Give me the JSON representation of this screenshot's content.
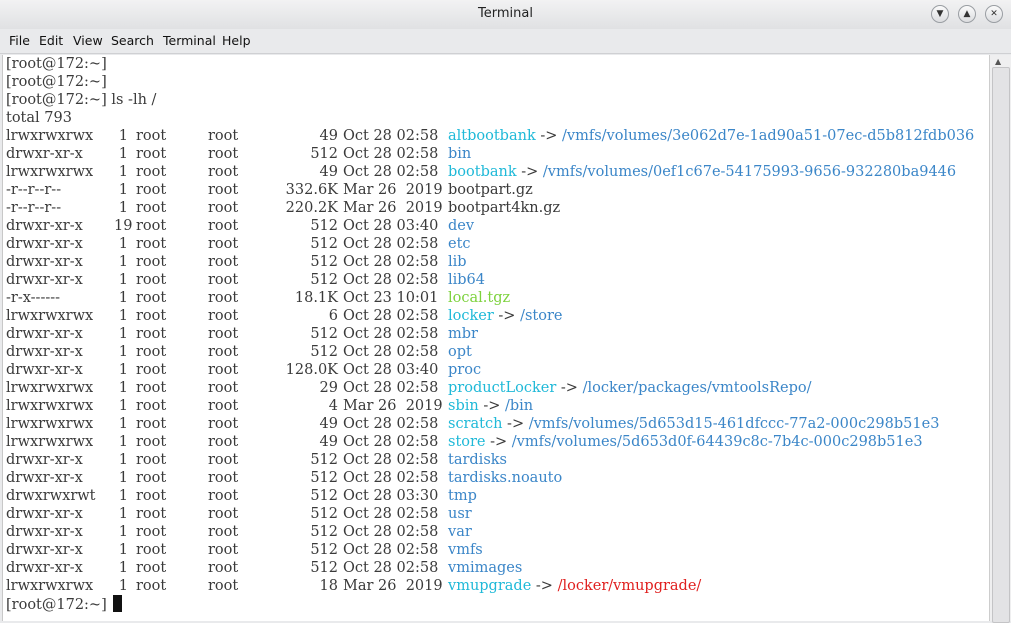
{
  "window": {
    "title": "Terminal",
    "buttons": [
      "minimize",
      "maximize",
      "close"
    ]
  },
  "menu": [
    "File",
    "Edit",
    "View",
    "Search",
    "Terminal",
    "Help"
  ],
  "prompt": "[root@172:~]",
  "command": "ls -lh /",
  "total": "total 793",
  "rows": [
    {
      "perm": "lrwxrwxrwx",
      "links": "1",
      "owner": "root",
      "group": "root",
      "size": "49",
      "date": "Oct 28 02:58",
      "name": "altbootbank",
      "type": "sym",
      "arrow": "->",
      "target": "/vmfs/volumes/3e062d7e-1ad90a51-07ec-d5b812fdb036",
      "target_type": "dir"
    },
    {
      "perm": "drwxr-xr-x",
      "links": "1",
      "owner": "root",
      "group": "root",
      "size": "512",
      "date": "Oct 28 02:58",
      "name": "bin",
      "type": "dir"
    },
    {
      "perm": "lrwxrwxrwx",
      "links": "1",
      "owner": "root",
      "group": "root",
      "size": "49",
      "date": "Oct 28 02:58",
      "name": "bootbank",
      "type": "sym",
      "arrow": "->",
      "target": "/vmfs/volumes/0ef1c67e-54175993-9656-932280ba9446",
      "target_type": "dir"
    },
    {
      "perm": "-r--r--r--",
      "links": "1",
      "owner": "root",
      "group": "root",
      "size": "332.6K",
      "date": "Mar 26  2019",
      "name": "bootpart.gz",
      "type": "file"
    },
    {
      "perm": "-r--r--r--",
      "links": "1",
      "owner": "root",
      "group": "root",
      "size": "220.2K",
      "date": "Mar 26  2019",
      "name": "bootpart4kn.gz",
      "type": "file"
    },
    {
      "perm": "drwxr-xr-x",
      "links": "19",
      "owner": "root",
      "group": "root",
      "size": "512",
      "date": "Oct 28 03:40",
      "name": "dev",
      "type": "dir"
    },
    {
      "perm": "drwxr-xr-x",
      "links": "1",
      "owner": "root",
      "group": "root",
      "size": "512",
      "date": "Oct 28 02:58",
      "name": "etc",
      "type": "dir"
    },
    {
      "perm": "drwxr-xr-x",
      "links": "1",
      "owner": "root",
      "group": "root",
      "size": "512",
      "date": "Oct 28 02:58",
      "name": "lib",
      "type": "dir"
    },
    {
      "perm": "drwxr-xr-x",
      "links": "1",
      "owner": "root",
      "group": "root",
      "size": "512",
      "date": "Oct 28 02:58",
      "name": "lib64",
      "type": "dir"
    },
    {
      "perm": "-r-x------",
      "links": "1",
      "owner": "root",
      "group": "root",
      "size": "18.1K",
      "date": "Oct 23 10:01",
      "name": "local.tgz",
      "type": "exe"
    },
    {
      "perm": "lrwxrwxrwx",
      "links": "1",
      "owner": "root",
      "group": "root",
      "size": "6",
      "date": "Oct 28 02:58",
      "name": "locker",
      "type": "sym",
      "arrow": "->",
      "target": "/store",
      "target_type": "dir"
    },
    {
      "perm": "drwxr-xr-x",
      "links": "1",
      "owner": "root",
      "group": "root",
      "size": "512",
      "date": "Oct 28 02:58",
      "name": "mbr",
      "type": "dir"
    },
    {
      "perm": "drwxr-xr-x",
      "links": "1",
      "owner": "root",
      "group": "root",
      "size": "512",
      "date": "Oct 28 02:58",
      "name": "opt",
      "type": "dir"
    },
    {
      "perm": "drwxr-xr-x",
      "links": "1",
      "owner": "root",
      "group": "root",
      "size": "128.0K",
      "date": "Oct 28 03:40",
      "name": "proc",
      "type": "dir"
    },
    {
      "perm": "lrwxrwxrwx",
      "links": "1",
      "owner": "root",
      "group": "root",
      "size": "29",
      "date": "Oct 28 02:58",
      "name": "productLocker",
      "type": "sym",
      "arrow": "->",
      "target": "/locker/packages/vmtoolsRepo/",
      "target_type": "dir"
    },
    {
      "perm": "lrwxrwxrwx",
      "links": "1",
      "owner": "root",
      "group": "root",
      "size": "4",
      "date": "Mar 26  2019",
      "name": "sbin",
      "type": "sym",
      "arrow": "->",
      "target": "/bin",
      "target_type": "dir"
    },
    {
      "perm": "lrwxrwxrwx",
      "links": "1",
      "owner": "root",
      "group": "root",
      "size": "49",
      "date": "Oct 28 02:58",
      "name": "scratch",
      "type": "sym",
      "arrow": "->",
      "target": "/vmfs/volumes/5d653d15-461dfccc-77a2-000c298b51e3",
      "target_type": "dir"
    },
    {
      "perm": "lrwxrwxrwx",
      "links": "1",
      "owner": "root",
      "group": "root",
      "size": "49",
      "date": "Oct 28 02:58",
      "name": "store",
      "type": "sym",
      "arrow": "->",
      "target": "/vmfs/volumes/5d653d0f-64439c8c-7b4c-000c298b51e3",
      "target_type": "dir"
    },
    {
      "perm": "drwxr-xr-x",
      "links": "1",
      "owner": "root",
      "group": "root",
      "size": "512",
      "date": "Oct 28 02:58",
      "name": "tardisks",
      "type": "dir"
    },
    {
      "perm": "drwxr-xr-x",
      "links": "1",
      "owner": "root",
      "group": "root",
      "size": "512",
      "date": "Oct 28 02:58",
      "name": "tardisks.noauto",
      "type": "dir"
    },
    {
      "perm": "drwxrwxrwt",
      "links": "1",
      "owner": "root",
      "group": "root",
      "size": "512",
      "date": "Oct 28 03:30",
      "name": "tmp",
      "type": "dir"
    },
    {
      "perm": "drwxr-xr-x",
      "links": "1",
      "owner": "root",
      "group": "root",
      "size": "512",
      "date": "Oct 28 02:58",
      "name": "usr",
      "type": "dir"
    },
    {
      "perm": "drwxr-xr-x",
      "links": "1",
      "owner": "root",
      "group": "root",
      "size": "512",
      "date": "Oct 28 02:58",
      "name": "var",
      "type": "dir"
    },
    {
      "perm": "drwxr-xr-x",
      "links": "1",
      "owner": "root",
      "group": "root",
      "size": "512",
      "date": "Oct 28 02:58",
      "name": "vmfs",
      "type": "dir"
    },
    {
      "perm": "drwxr-xr-x",
      "links": "1",
      "owner": "root",
      "group": "root",
      "size": "512",
      "date": "Oct 28 02:58",
      "name": "vmimages",
      "type": "dir"
    },
    {
      "perm": "lrwxrwxrwx",
      "links": "1",
      "owner": "root",
      "group": "root",
      "size": "18",
      "date": "Mar 26  2019",
      "name": "vmupgrade",
      "type": "sym",
      "arrow": "->",
      "target": "/locker/vmupgrade/",
      "target_type": "broken"
    }
  ],
  "colors": {
    "symlink": "#1fb9d8",
    "directory": "#3b86c8",
    "executable": "#7dd23d",
    "broken_target": "#e0201f",
    "text": "#3a3a3a"
  }
}
